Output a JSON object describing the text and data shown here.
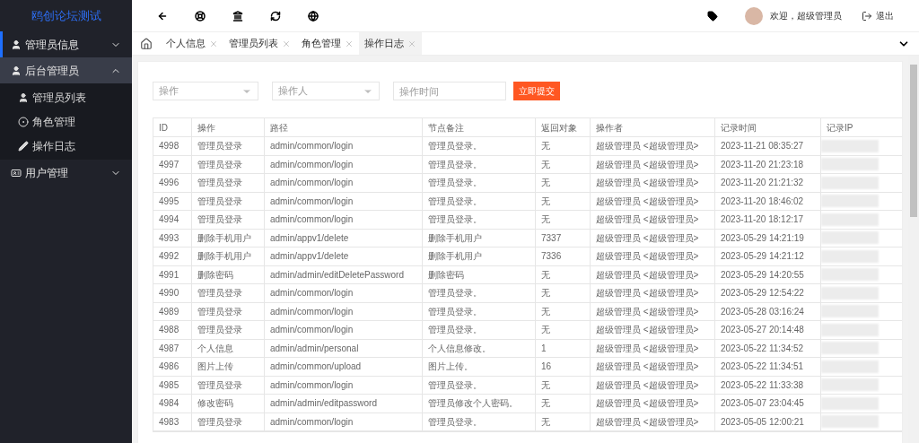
{
  "sidebar": {
    "logo": "鸥创论坛测试",
    "items": [
      {
        "label": "管理员信息",
        "expanded": false,
        "selected": false
      },
      {
        "label": "后台管理员",
        "expanded": true,
        "selected": true,
        "children": [
          {
            "label": "管理员列表"
          },
          {
            "label": "角色管理"
          },
          {
            "label": "操作日志"
          }
        ]
      },
      {
        "label": "用户管理",
        "expanded": false,
        "selected": false
      }
    ]
  },
  "header": {
    "welcome": "欢迎，超级管理员",
    "logout": "退出"
  },
  "tabs": [
    {
      "label": "个人信息",
      "selected": false
    },
    {
      "label": "管理员列表",
      "selected": false
    },
    {
      "label": "角色管理",
      "selected": false
    },
    {
      "label": "操作日志",
      "selected": true
    }
  ],
  "filters": {
    "action": {
      "placeholder": "操作"
    },
    "operator": {
      "placeholder": "操作人"
    },
    "time": {
      "placeholder": "操作时间"
    },
    "submit": "立即提交"
  },
  "table": {
    "columns": [
      "ID",
      "操作",
      "路径",
      "节点备注",
      "返回对象",
      "操作者",
      "记录时间",
      "记录IP"
    ],
    "rows": [
      [
        "4998",
        "管理员登录",
        "admin/common/login",
        "管理员登录。",
        "无",
        "超级管理员 <超级管理员>",
        "2023-11-21 08:35:27"
      ],
      [
        "4997",
        "管理员登录",
        "admin/common/login",
        "管理员登录。",
        "无",
        "超级管理员 <超级管理员>",
        "2023-11-20 21:23:18"
      ],
      [
        "4996",
        "管理员登录",
        "admin/common/login",
        "管理员登录。",
        "无",
        "超级管理员 <超级管理员>",
        "2023-11-20 21:21:32"
      ],
      [
        "4995",
        "管理员登录",
        "admin/common/login",
        "管理员登录。",
        "无",
        "超级管理员 <超级管理员>",
        "2023-11-20 18:46:02"
      ],
      [
        "4994",
        "管理员登录",
        "admin/common/login",
        "管理员登录。",
        "无",
        "超级管理员 <超级管理员>",
        "2023-11-20 18:12:17"
      ],
      [
        "4993",
        "删除手机用户",
        "admin/appv1/delete",
        "删除手机用户",
        "7337",
        "超级管理员 <超级管理员>",
        "2023-05-29 14:21:19"
      ],
      [
        "4992",
        "删除手机用户",
        "admin/appv1/delete",
        "删除手机用户",
        "7336",
        "超级管理员 <超级管理员>",
        "2023-05-29 14:21:12"
      ],
      [
        "4991",
        "删除密码",
        "admin/admin/editDeletePassword",
        "删除密码",
        "无",
        "超级管理员 <超级管理员>",
        "2023-05-29 14:20:55"
      ],
      [
        "4990",
        "管理员登录",
        "admin/common/login",
        "管理员登录。",
        "无",
        "超级管理员 <超级管理员>",
        "2023-05-29 12:54:22"
      ],
      [
        "4989",
        "管理员登录",
        "admin/common/login",
        "管理员登录。",
        "无",
        "超级管理员 <超级管理员>",
        "2023-05-28 03:16:24"
      ],
      [
        "4988",
        "管理员登录",
        "admin/common/login",
        "管理员登录。",
        "无",
        "超级管理员 <超级管理员>",
        "2023-05-27 20:14:48"
      ],
      [
        "4987",
        "个人信息",
        "admin/admin/personal",
        "个人信息修改。",
        "1",
        "超级管理员 <超级管理员>",
        "2023-05-22 11:34:52"
      ],
      [
        "4986",
        "图片上传",
        "admin/common/upload",
        "图片上传。",
        "16",
        "超级管理员 <超级管理员>",
        "2023-05-22 11:34:51"
      ],
      [
        "4985",
        "管理员登录",
        "admin/common/login",
        "管理员登录。",
        "无",
        "超级管理员 <超级管理员>",
        "2023-05-22 11:33:38"
      ],
      [
        "4984",
        "修改密码",
        "admin/admin/editpassword",
        "管理员修改个人密码。",
        "无",
        "超级管理员 <超级管理员>",
        "2023-05-07 23:04:45"
      ],
      [
        "4983",
        "管理员登录",
        "admin/common/login",
        "管理员登录。",
        "无",
        "超级管理员 <超级管理员>",
        "2023-05-05 12:00:21"
      ]
    ]
  }
}
